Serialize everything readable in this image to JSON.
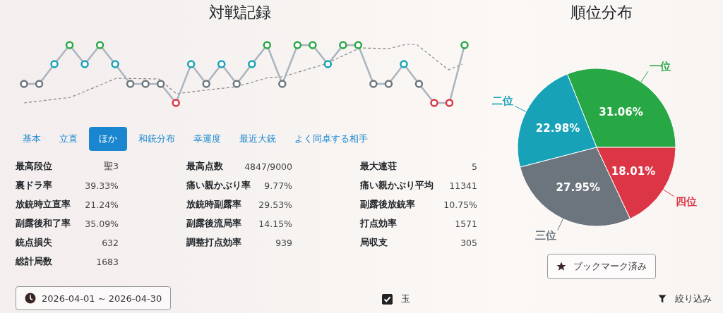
{
  "record_panel": {
    "title": "対戦記録",
    "tabs": [
      {
        "label": "基本",
        "selected": false
      },
      {
        "label": "立直",
        "selected": false
      },
      {
        "label": "ほか",
        "selected": true
      },
      {
        "label": "和銃分布",
        "selected": false
      },
      {
        "label": "幸運度",
        "selected": false
      },
      {
        "label": "最近大銃",
        "selected": false
      },
      {
        "label": "よく同卓する相手",
        "selected": false
      }
    ],
    "stats": [
      {
        "label": "最高段位",
        "value": "聖3"
      },
      {
        "label": "最高点数",
        "value": "4847/9000"
      },
      {
        "label": "最大連荘",
        "value": "5"
      },
      {
        "label": "裏ドラ率",
        "value": "39.33%"
      },
      {
        "label": "痛い親かぶり率",
        "value": "9.77%"
      },
      {
        "label": "痛い親かぶり平均",
        "value": "11341"
      },
      {
        "label": "放銃時立直率",
        "value": "21.24%"
      },
      {
        "label": "放銃時副露率",
        "value": "29.53%"
      },
      {
        "label": "副露後放銃率",
        "value": "10.75%"
      },
      {
        "label": "副露後和了率",
        "value": "35.09%"
      },
      {
        "label": "副露後流局率",
        "value": "14.15%"
      },
      {
        "label": "打点効率",
        "value": "1571"
      },
      {
        "label": "銃点損失",
        "value": "632"
      },
      {
        "label": "調整打点効率",
        "value": "939"
      },
      {
        "label": "局収支",
        "value": "305"
      },
      {
        "label": "総計局数",
        "value": "1683"
      }
    ],
    "date_range_button": {
      "label": "2026-04-01 ~ 2026-04-30"
    }
  },
  "rank_panel": {
    "title": "順位分布",
    "chart_data": {
      "type": "pie",
      "categories": [
        "一位",
        "二位",
        "三位",
        "四位"
      ],
      "values": [
        31.06,
        22.98,
        27.95,
        18.01
      ],
      "colors": [
        "#28a745",
        "#17a2b8",
        "#6c757d",
        "#dc3545"
      ],
      "value_labels": [
        "31.06%",
        "22.98%",
        "27.95%",
        "18.01%"
      ]
    },
    "bookmark_button": {
      "label": "ブックマーク済み"
    }
  },
  "footer": {
    "checkbox": {
      "label": "玉",
      "checked": true
    },
    "filter_button": {
      "label": "絞り込み"
    }
  }
}
